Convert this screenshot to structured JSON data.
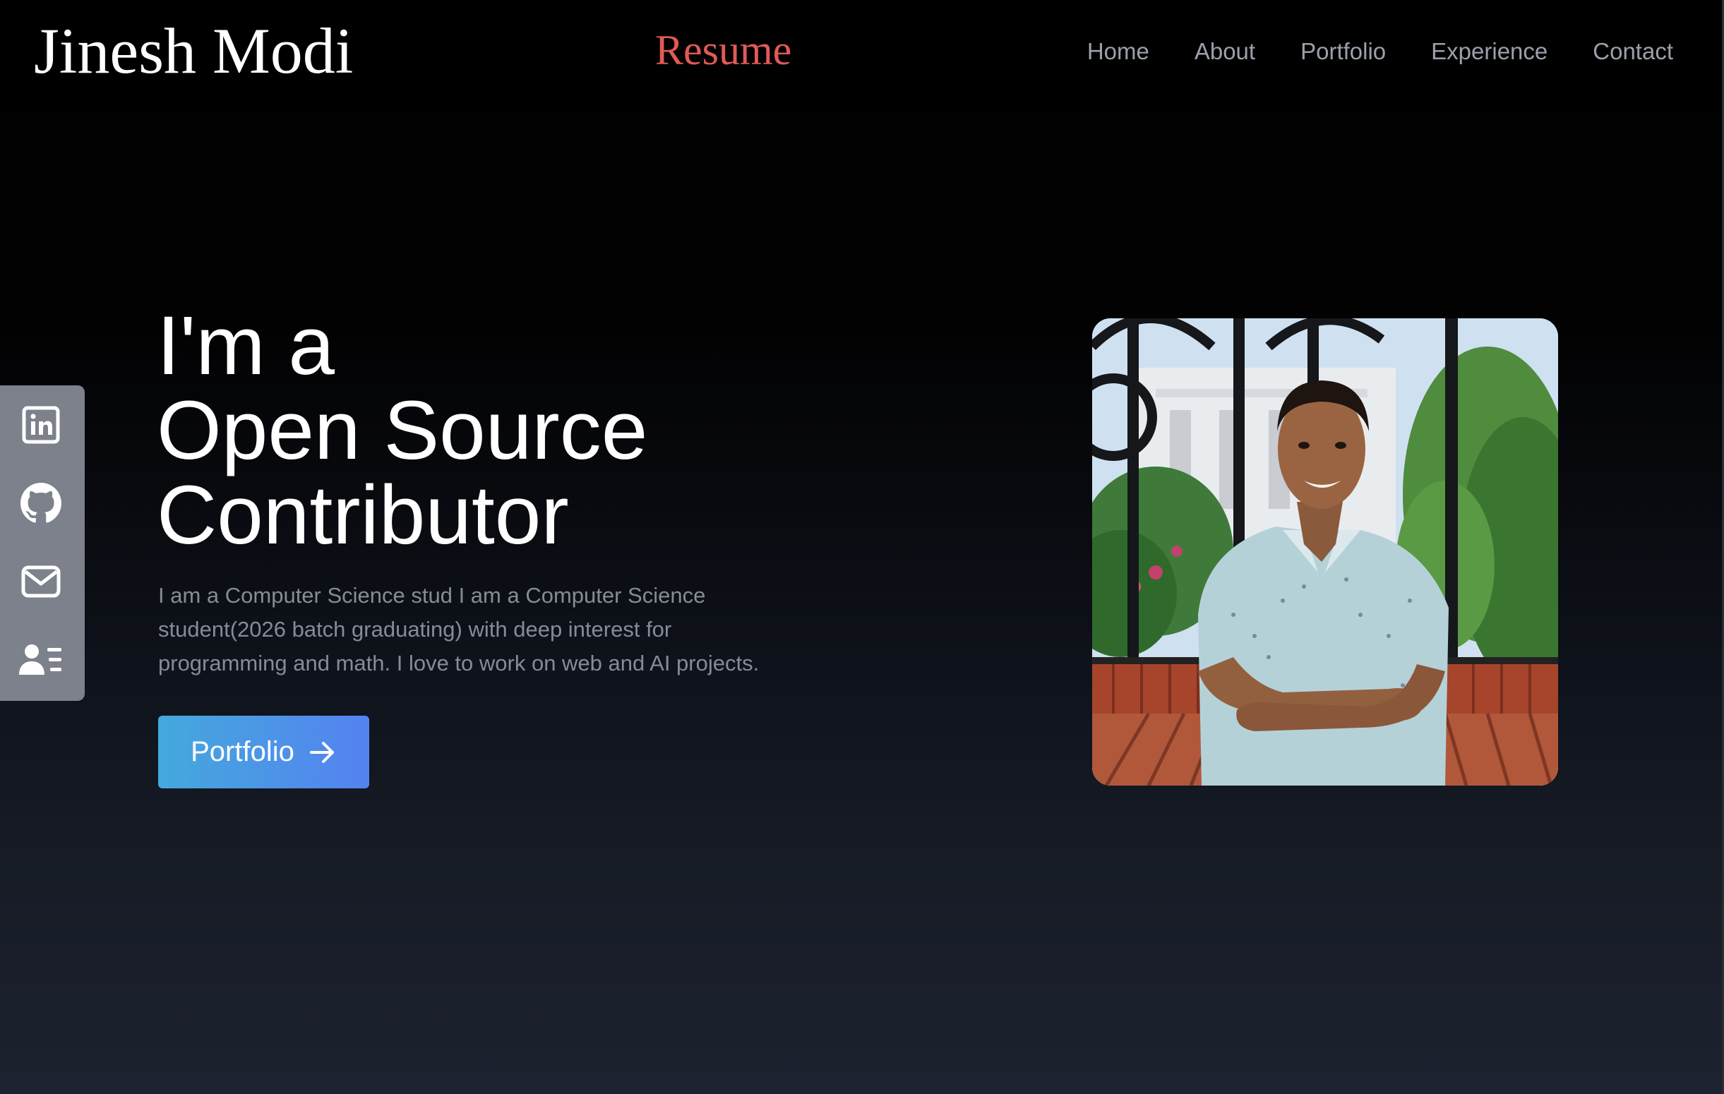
{
  "header": {
    "logo": "Jinesh Modi",
    "resume_label": "Resume",
    "nav": [
      "Home",
      "About",
      "Portfolio",
      "Experience",
      "Contact"
    ]
  },
  "social": {
    "items": [
      {
        "name": "linkedin",
        "icon": "linkedin-icon"
      },
      {
        "name": "github",
        "icon": "github-icon"
      },
      {
        "name": "email",
        "icon": "mail-icon"
      },
      {
        "name": "resume",
        "icon": "user-card-icon"
      }
    ]
  },
  "hero": {
    "title_line1": "I'm a",
    "title_line2": "Open Source",
    "title_line3": "Contributor",
    "description": "I am a Computer Science stud I am a Computer Science student(2026 batch graduating) with deep interest for programming and math. I love to work on web and AI projects.",
    "button_label": "Portfolio",
    "button_icon": "arrow-right-icon"
  },
  "photo": {
    "subject": "profile-photo"
  },
  "colors": {
    "accent_resume": "#e05a57",
    "nav_text": "#9aa0ab",
    "sidebar_bg": "#7d818c",
    "button_gradient_start": "#44a9dd",
    "button_gradient_end": "#5482f0"
  }
}
